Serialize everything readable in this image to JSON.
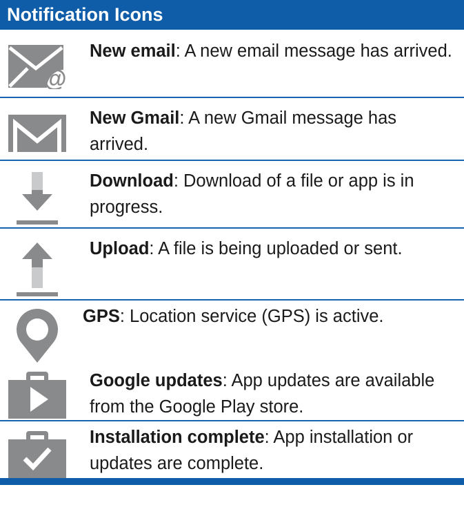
{
  "header": {
    "title": "Notification Icons"
  },
  "colors": {
    "header_bg": "#0f5ca8",
    "rule": "#1763ad",
    "icon_gray": "#888a8c",
    "icon_light": "#c9cacb"
  },
  "rows": [
    {
      "icon": "email-icon",
      "title": "New email",
      "description": ": A new email message has arrived."
    },
    {
      "icon": "gmail-icon",
      "title": "New Gmail",
      "description": ": A new Gmail message has arrived."
    },
    {
      "icon": "download-icon",
      "title": "Download",
      "description": ": Download of a file or app is in progress."
    },
    {
      "icon": "upload-icon",
      "title": "Upload",
      "description": ": A file is being uploaded or sent."
    },
    {
      "icon": "gps-icon",
      "title": "GPS",
      "description": ": Location service (GPS) is active."
    },
    {
      "icon": "google-updates-icon",
      "title": "Google updates",
      "description": ": App updates are available from the Google Play store."
    },
    {
      "icon": "installation-complete-icon",
      "title": "Installation complete",
      "description": ": App installation or updates are complete."
    }
  ]
}
